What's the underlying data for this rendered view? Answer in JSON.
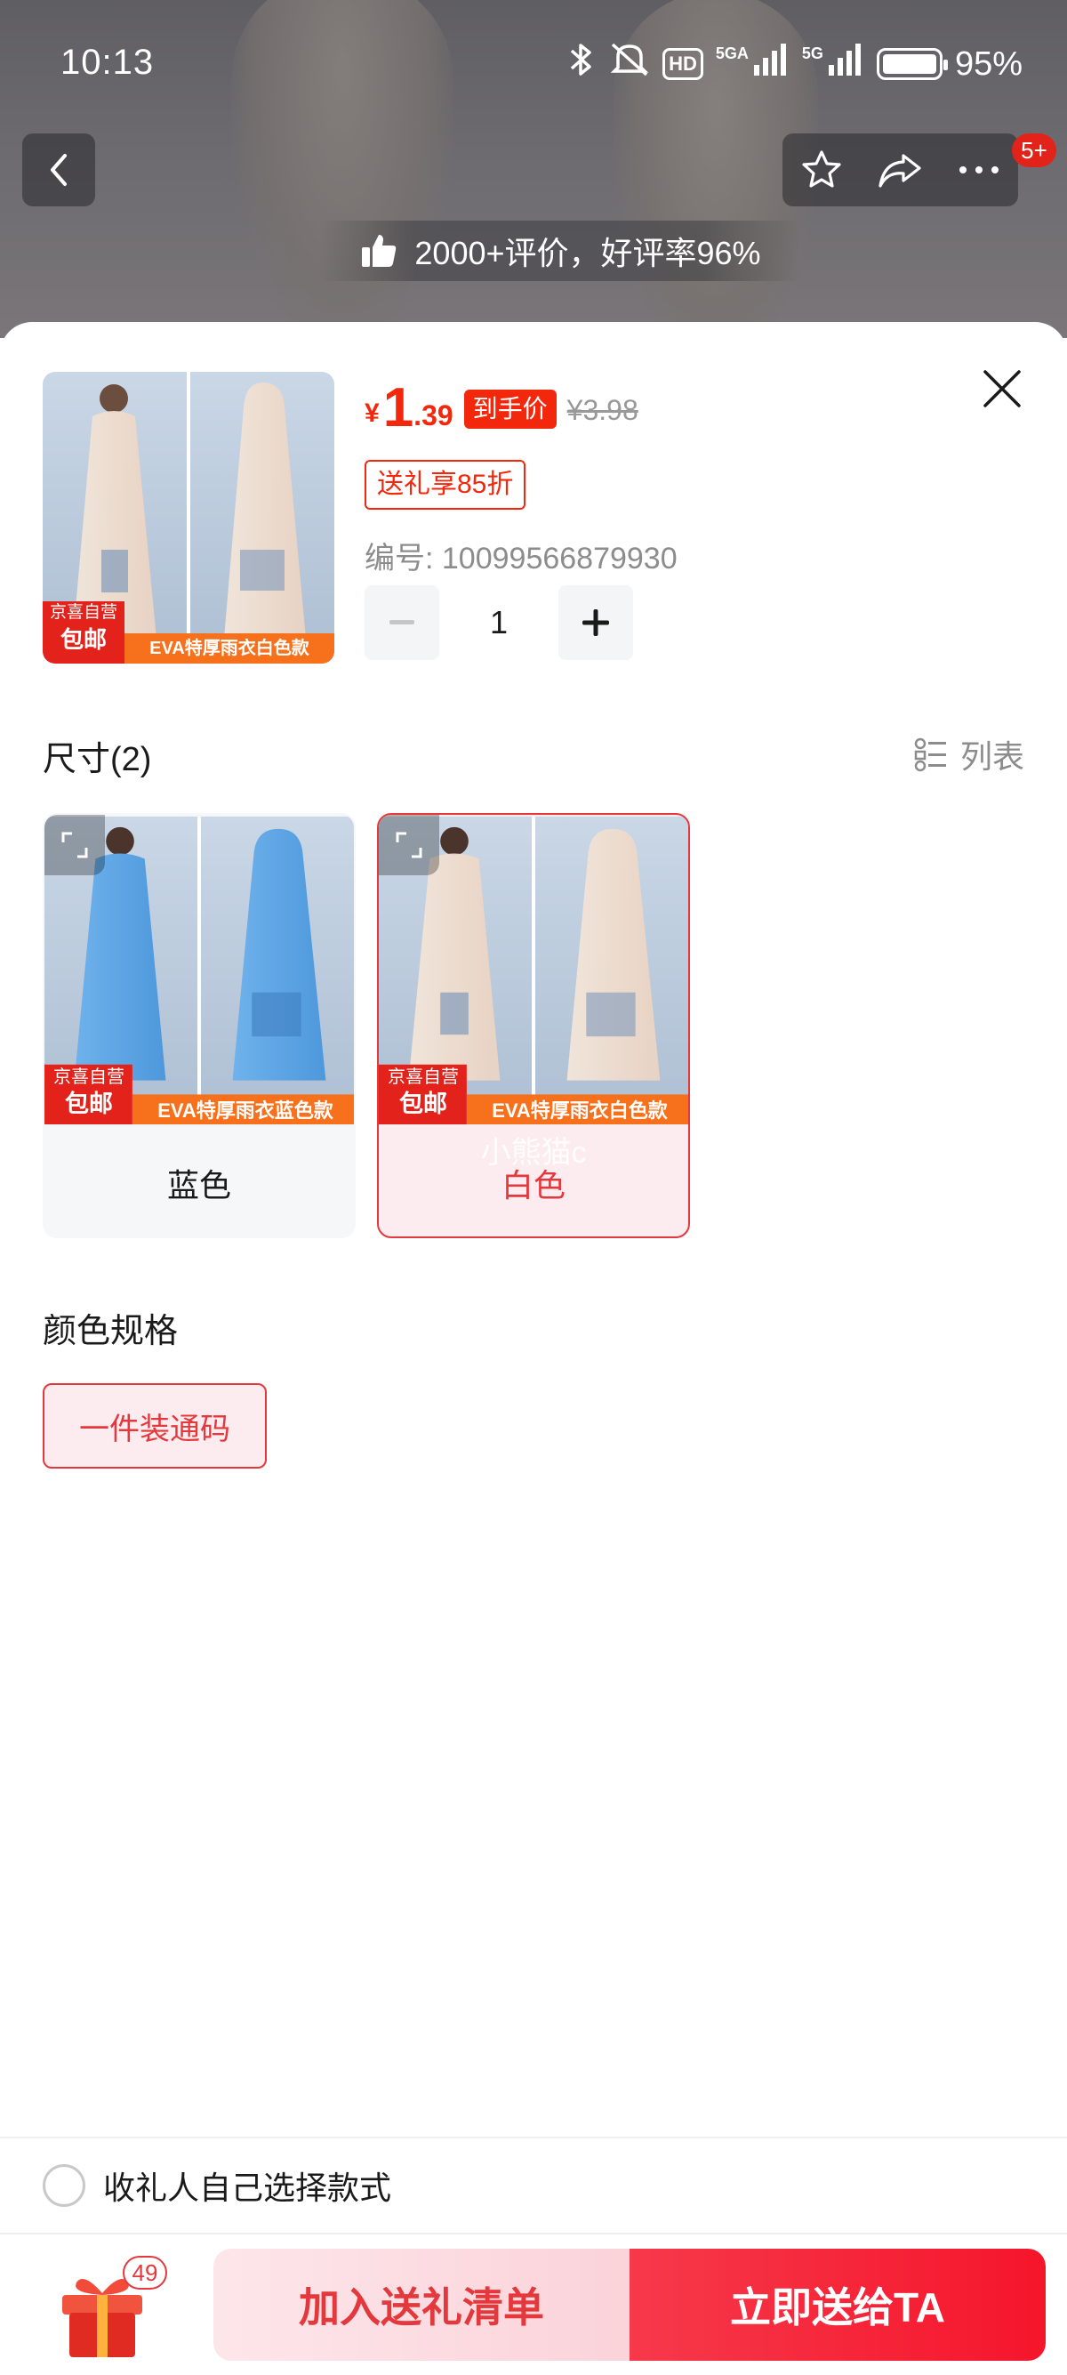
{
  "status_bar": {
    "time": "10:13",
    "hd": "HD",
    "sig1": "5GA",
    "sig2": "5G",
    "battery": "95%"
  },
  "top_nav": {
    "badge_count": "5+"
  },
  "rating": {
    "text": "2000+评价，好评率96%"
  },
  "product": {
    "currency": "¥",
    "price_int": "1",
    "price_dec": ".39",
    "price_tag": "到手价",
    "original_price": "¥3.98",
    "promo_tag": "送礼享85折",
    "sku_label": "编号: 10099566879930",
    "quantity": "1",
    "image_badges": {
      "store": "京喜自营",
      "shipping": "包邮",
      "caption_white": "EVA特厚雨衣白色款",
      "caption_blue": "EVA特厚雨衣蓝色款"
    }
  },
  "size_section": {
    "title": "尺寸(2)",
    "list_toggle": "列表",
    "options": [
      {
        "label": "蓝色",
        "selected": false
      },
      {
        "label": "白色",
        "selected": true
      }
    ],
    "watermark": "小熊猫c"
  },
  "spec_section": {
    "title": "颜色规格",
    "options": [
      {
        "label": "一件装通码",
        "selected": true
      }
    ]
  },
  "recipient": {
    "label": "收礼人自己选择款式"
  },
  "bottom_bar": {
    "gift_count": "49",
    "add_button": "加入送礼清单",
    "send_button": "立即送给TA"
  },
  "colors": {
    "accent_red": "#e4393c",
    "price_red": "#f2270c",
    "selected_bg": "#fdecef"
  }
}
